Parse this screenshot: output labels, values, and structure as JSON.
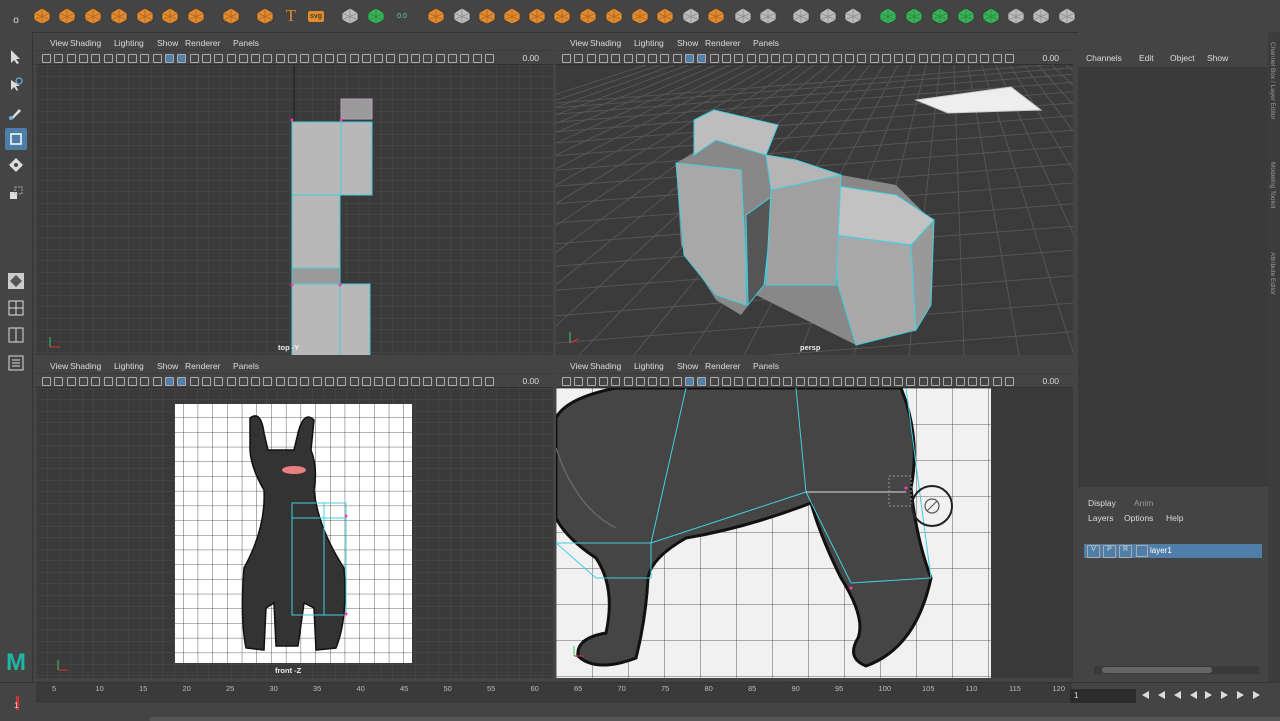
{
  "panel_menus": [
    "View",
    "Shading",
    "Lighting",
    "Show",
    "Renderer",
    "Panels"
  ],
  "panel_value": "0.00",
  "viewports": {
    "top": {
      "label": "top -Y"
    },
    "persp": {
      "label": "persp"
    },
    "front": {
      "label": "front -Z"
    }
  },
  "channel_box": {
    "menu": [
      "Channels",
      "Edit",
      "Object",
      "Show"
    ],
    "side_tabs": [
      "Channel Box / Layer Editor",
      "Modeling Toolkit",
      "Attribute Editor"
    ]
  },
  "layer_editor": {
    "tabs": [
      "Display",
      "Anim"
    ],
    "menu": [
      "Layers",
      "Options",
      "Help"
    ],
    "layer": {
      "v": "V",
      "p": "P",
      "r": "R",
      "name": "layer1"
    }
  },
  "timeline": {
    "ticks": [
      "5",
      "10",
      "15",
      "20",
      "25",
      "30",
      "35",
      "40",
      "45",
      "50",
      "55",
      "60",
      "65",
      "70",
      "75",
      "80",
      "85",
      "90",
      "95",
      "100",
      "105",
      "110",
      "115",
      "120"
    ],
    "current_frame": "1",
    "frame_field": "1"
  },
  "shelf_svg_label": "svg",
  "shelf_value": "0.0",
  "logo_letter": "M",
  "colors": {
    "orange": "#e38a2e",
    "green": "#38b257",
    "wire": "#40d0e0",
    "bg": "#444444",
    "viewport": "#3a3a3a",
    "highlight": "#4f7ea8"
  }
}
